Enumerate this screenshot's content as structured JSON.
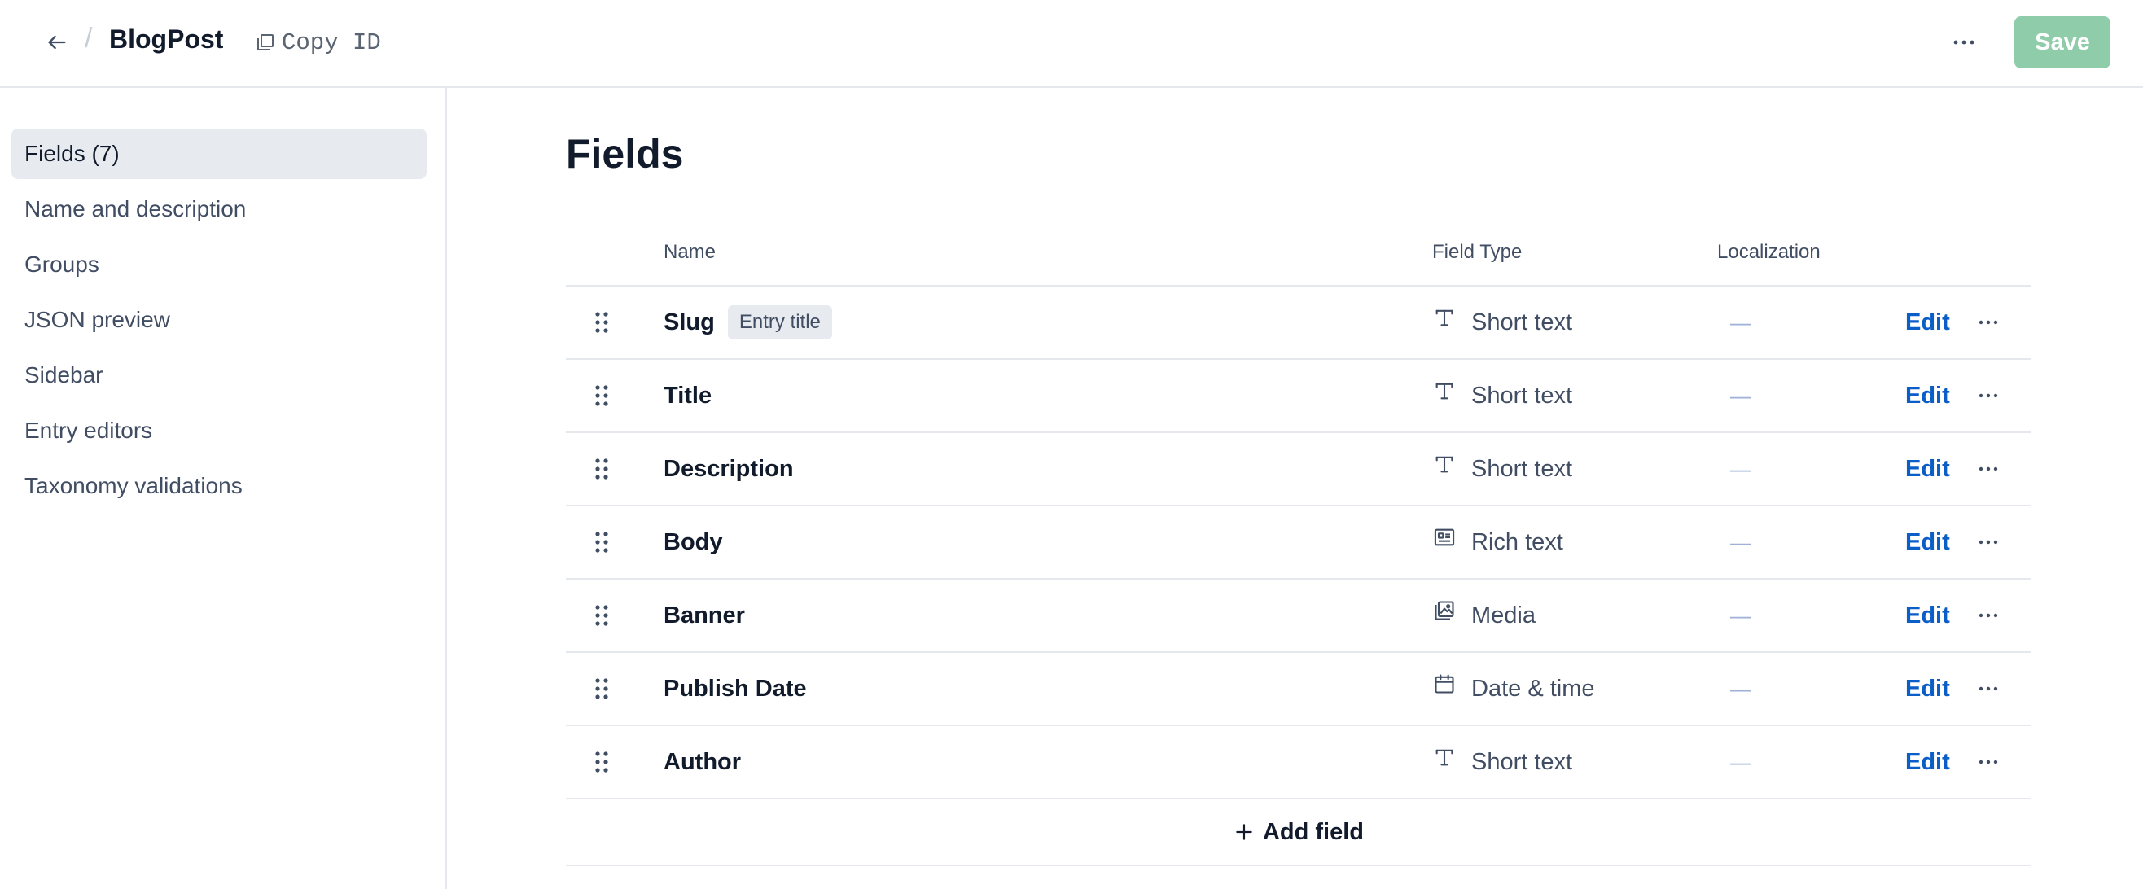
{
  "header": {
    "title": "BlogPost",
    "separator": "/",
    "copy_id_label": "Copy ID",
    "save_label": "Save",
    "back_icon": "arrow-left-icon",
    "copy_icon": "copy-icon",
    "more_icon": "more-horizontal-icon"
  },
  "sidebar": {
    "items": [
      {
        "label": "Fields (7)",
        "active": true
      },
      {
        "label": "Name and description",
        "active": false
      },
      {
        "label": "Groups",
        "active": false
      },
      {
        "label": "JSON preview",
        "active": false
      },
      {
        "label": "Sidebar",
        "active": false
      },
      {
        "label": "Entry editors",
        "active": false
      },
      {
        "label": "Taxonomy validations",
        "active": false
      }
    ]
  },
  "main": {
    "heading": "Fields",
    "columns": {
      "name": "Name",
      "field_type": "Field Type",
      "localization": "Localization"
    },
    "fields": [
      {
        "name": "Slug",
        "badge": "Entry title",
        "type": "Short text",
        "type_icon": "text-t-icon",
        "localization": "—",
        "edit": "Edit"
      },
      {
        "name": "Title",
        "badge": "",
        "type": "Short text",
        "type_icon": "text-t-icon",
        "localization": "—",
        "edit": "Edit"
      },
      {
        "name": "Description",
        "badge": "",
        "type": "Short text",
        "type_icon": "text-t-icon",
        "localization": "—",
        "edit": "Edit"
      },
      {
        "name": "Body",
        "badge": "",
        "type": "Rich text",
        "type_icon": "rich-text-icon",
        "localization": "—",
        "edit": "Edit"
      },
      {
        "name": "Banner",
        "badge": "",
        "type": "Media",
        "type_icon": "media-icon",
        "localization": "—",
        "edit": "Edit"
      },
      {
        "name": "Publish Date",
        "badge": "",
        "type": "Date & time",
        "type_icon": "calendar-icon",
        "localization": "—",
        "edit": "Edit"
      },
      {
        "name": "Author",
        "badge": "",
        "type": "Short text",
        "type_icon": "text-t-icon",
        "localization": "—",
        "edit": "Edit"
      }
    ],
    "add_field_label": "Add field"
  },
  "colors": {
    "accent_link": "#0b5ec8",
    "save_button": "#8fccaa",
    "active_sidebar": "#e7eaee",
    "border": "#e5e8ec"
  }
}
